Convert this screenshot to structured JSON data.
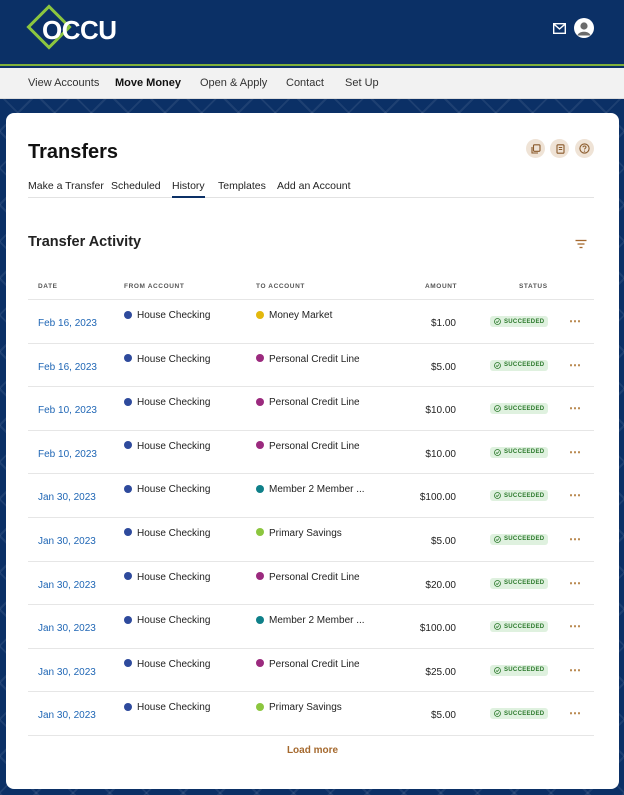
{
  "brand": {
    "name": "OCCU",
    "accent": "#8cc63f",
    "navy": "#0b3066"
  },
  "nav": {
    "items": [
      {
        "label": "View Accounts",
        "active": false
      },
      {
        "label": "Move Money",
        "active": true
      },
      {
        "label": "Open & Apply",
        "active": false
      },
      {
        "label": "Contact",
        "active": false
      },
      {
        "label": "Set Up",
        "active": false
      }
    ]
  },
  "page": {
    "title": "Transfers",
    "tabs": [
      "Make a Transfer",
      "Scheduled",
      "History",
      "Templates",
      "Add an Account"
    ],
    "active_tab": "History",
    "actions": [
      "copy-icon",
      "document-icon",
      "help-icon"
    ]
  },
  "section": {
    "title": "Transfer Activity"
  },
  "table": {
    "columns": [
      "DATE",
      "FROM ACCOUNT",
      "TO ACCOUNT",
      "AMOUNT",
      "STATUS"
    ],
    "account_colors": {
      "House Checking": "#2e4a9c",
      "Money Market": "#e3b80d",
      "Personal Credit Line": "#9b2a7e",
      "Member 2 Member ...": "#0f8089",
      "Primary Savings": "#8cc63f"
    },
    "rows": [
      {
        "date": "Feb 16, 2023",
        "from": "House Checking",
        "to": "Money Market",
        "amount": "$1.00",
        "status": "SUCCEEDED"
      },
      {
        "date": "Feb 16, 2023",
        "from": "House Checking",
        "to": "Personal Credit Line",
        "amount": "$5.00",
        "status": "SUCCEEDED"
      },
      {
        "date": "Feb 10, 2023",
        "from": "House Checking",
        "to": "Personal Credit Line",
        "amount": "$10.00",
        "status": "SUCCEEDED"
      },
      {
        "date": "Feb 10, 2023",
        "from": "House Checking",
        "to": "Personal Credit Line",
        "amount": "$10.00",
        "status": "SUCCEEDED"
      },
      {
        "date": "Jan 30, 2023",
        "from": "House Checking",
        "to": "Member 2 Member ...",
        "amount": "$100.00",
        "status": "SUCCEEDED"
      },
      {
        "date": "Jan 30, 2023",
        "from": "House Checking",
        "to": "Primary Savings",
        "amount": "$5.00",
        "status": "SUCCEEDED"
      },
      {
        "date": "Jan 30, 2023",
        "from": "House Checking",
        "to": "Personal Credit Line",
        "amount": "$20.00",
        "status": "SUCCEEDED"
      },
      {
        "date": "Jan 30, 2023",
        "from": "House Checking",
        "to": "Member 2 Member ...",
        "amount": "$100.00",
        "status": "SUCCEEDED"
      },
      {
        "date": "Jan 30, 2023",
        "from": "House Checking",
        "to": "Personal Credit Line",
        "amount": "$25.00",
        "status": "SUCCEEDED"
      },
      {
        "date": "Jan 30, 2023",
        "from": "House Checking",
        "to": "Primary Savings",
        "amount": "$5.00",
        "status": "SUCCEEDED"
      }
    ],
    "row_menu_icon": "more-horizontal-icon",
    "load_more_label": "Load more"
  },
  "header_icons": [
    "mail-icon",
    "user-avatar-icon"
  ]
}
